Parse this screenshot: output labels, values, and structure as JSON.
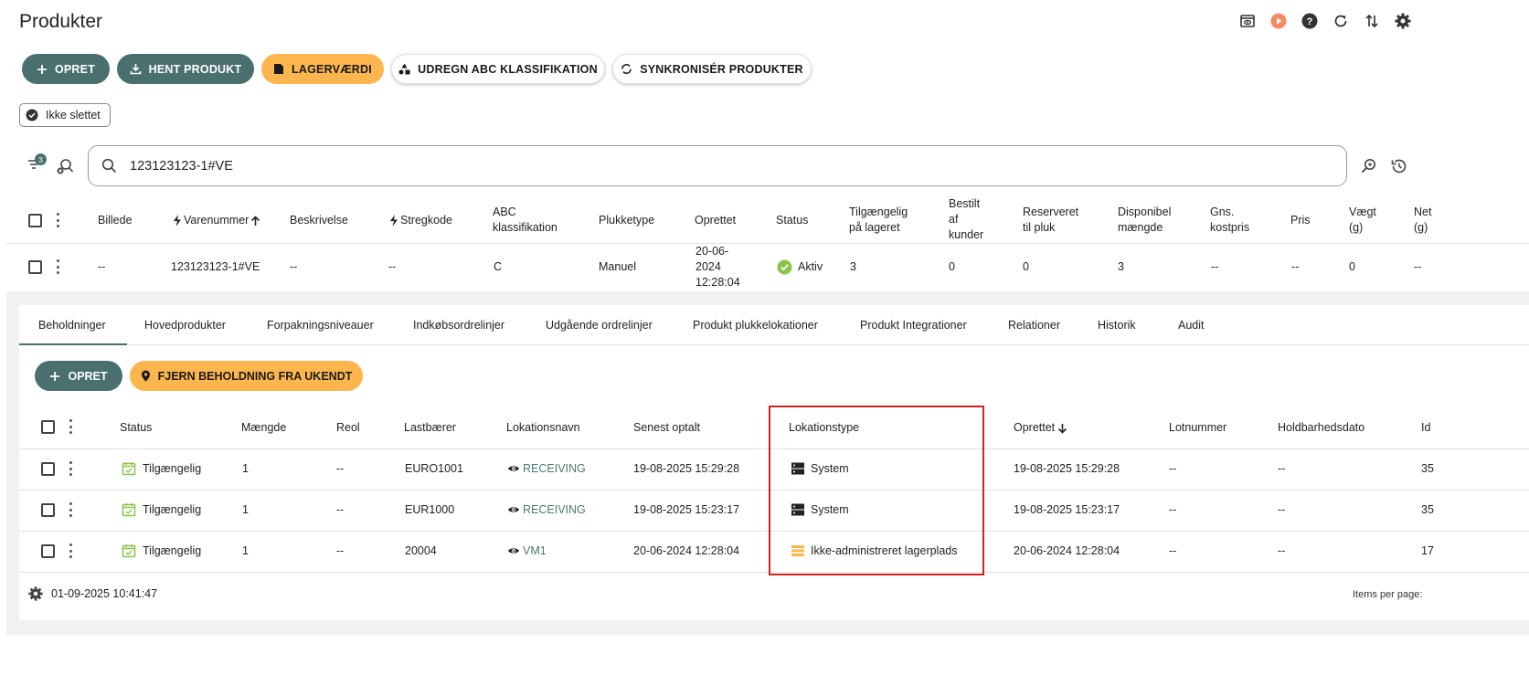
{
  "page": {
    "title": "Produkter"
  },
  "top_icons": [
    "eye-icon",
    "play-icon",
    "help-icon",
    "refresh-icon",
    "sort-icon",
    "gear-icon"
  ],
  "toolbar": {
    "create": "OPRET",
    "fetch_product": "HENT PRODUKT",
    "stock_value": "LAGERVÆRDI",
    "abc": "UDREGN ABC KLASSIFIKATION",
    "sync": "SYNKRONISÉR PRODUKTER"
  },
  "filter_chip": "Ikke slettet",
  "filter_count": "3",
  "search": {
    "value": "123123123-1#VE"
  },
  "product_table": {
    "headers": {
      "image": "Billede",
      "sku": "Varenummer",
      "description": "Beskrivelse",
      "barcode": "Stregkode",
      "abc": [
        "ABC",
        "klassifikation"
      ],
      "pick_type": "Plukketype",
      "created": "Oprettet",
      "status": "Status",
      "available": [
        "Tilgængelig",
        "på lageret"
      ],
      "ordered": [
        "Bestilt",
        "af",
        "kunder"
      ],
      "reserved": [
        "Reserveret",
        "til pluk"
      ],
      "disposable": [
        "Disponibel",
        "mængde"
      ],
      "avg_cost": [
        "Gns.",
        "kostpris"
      ],
      "price": "Pris",
      "weight": [
        "Vægt",
        "(g)"
      ],
      "net": [
        "Net",
        "(g)"
      ]
    },
    "row": {
      "image": "--",
      "sku": "123123123-1#VE",
      "description": "--",
      "barcode": "--",
      "abc": "C",
      "pick_type": "Manuel",
      "created": [
        "20-06-",
        "2024",
        "12:28:04"
      ],
      "status": "Aktiv",
      "available": "3",
      "ordered": "0",
      "reserved": "0",
      "disposable": "3",
      "avg_cost": "--",
      "price": "--",
      "weight": "0",
      "net": "--"
    }
  },
  "tabs": [
    "Beholdninger",
    "Hovedprodukter",
    "Forpakningsniveauer",
    "Indkøbsordrelinjer",
    "Udgående ordrelinjer",
    "Produkt plukkelokationer",
    "Produkt Integrationer",
    "Relationer",
    "Historik",
    "Audit"
  ],
  "holdings": {
    "create": "OPRET",
    "remove_unknown": "FJERN BEHOLDNING FRA UKENDT",
    "headers": {
      "status": "Status",
      "qty": "Mængde",
      "shelf": "Reol",
      "carrier": "Lastbærer",
      "location": "Lokationsnavn",
      "last_counted": "Senest optalt",
      "location_type": "Lokationstype",
      "created": "Oprettet",
      "lot": "Lotnummer",
      "expiry": "Holdbarhedsdato",
      "id": "Id"
    },
    "rows": [
      {
        "status": "Tilgængelig",
        "qty": "1",
        "shelf": "--",
        "carrier": "EURO1001",
        "location": "RECEIVING",
        "last_counted": "19-08-2025 15:29:28",
        "location_type": "System",
        "type_icon": "server-icon",
        "created": "19-08-2025 15:29:28",
        "lot": "--",
        "expiry": "--",
        "id": "35"
      },
      {
        "status": "Tilgængelig",
        "qty": "1",
        "shelf": "--",
        "carrier": "EUR1000",
        "location": "RECEIVING",
        "last_counted": "19-08-2025 15:23:17",
        "location_type": "System",
        "type_icon": "server-icon",
        "created": "19-08-2025 15:23:17",
        "lot": "--",
        "expiry": "--",
        "id": "35"
      },
      {
        "status": "Tilgængelig",
        "qty": "1",
        "shelf": "--",
        "carrier": "20004",
        "location": "VM1",
        "last_counted": "20-06-2024 12:28:04",
        "location_type": "Ikke-administreret lagerplads",
        "type_icon": "list-icon",
        "created": "20-06-2024 12:28:04",
        "lot": "--",
        "expiry": "--",
        "id": "17"
      }
    ]
  },
  "footer": {
    "timestamp": "01-09-2025 10:41:47",
    "items_per_page": "Items per page:"
  },
  "colors": {
    "teal": "#4a6f6f",
    "orange": "#fdb64d",
    "green": "#8bc34a",
    "highlight": "#d32020",
    "link": "#4a7a72"
  }
}
